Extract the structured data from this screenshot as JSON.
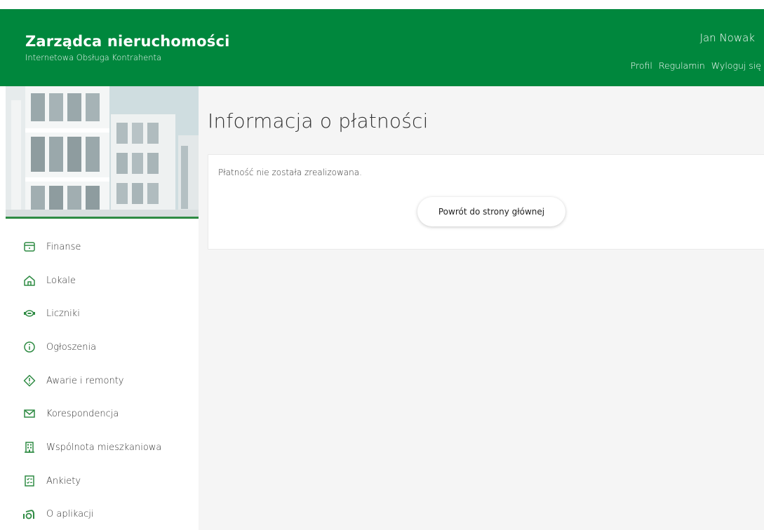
{
  "header": {
    "brand_title": "Zarządca nieruchomości",
    "brand_subtitle": "Internetowa Obsługa Kontrahenta",
    "user_name": "Jan Nowak",
    "links": [
      "Profil",
      "Regulamin",
      "Wyloguj się"
    ],
    "background_color": "#00873d"
  },
  "sidebar": {
    "accent_color": "#2e8b43",
    "items": [
      {
        "label": "Finanse",
        "icon": "wallet-icon"
      },
      {
        "label": "Lokale",
        "icon": "home-icon"
      },
      {
        "label": "Liczniki",
        "icon": "meter-icon"
      },
      {
        "label": "Ogłoszenia",
        "icon": "info-icon"
      },
      {
        "label": "Awarie i remonty",
        "icon": "alert-icon"
      },
      {
        "label": "Korespondencja",
        "icon": "envelope-icon"
      },
      {
        "label": "Wspólnota mieszkaniowa",
        "icon": "building-icon"
      },
      {
        "label": "Ankiety",
        "icon": "survey-icon"
      },
      {
        "label": "O aplikacji",
        "icon": "app-info-icon"
      }
    ]
  },
  "main": {
    "title": "Informacja o płatności",
    "message": "Płatność nie została zrealizowana.",
    "back_button_label": "Powrót do strony głównej"
  }
}
